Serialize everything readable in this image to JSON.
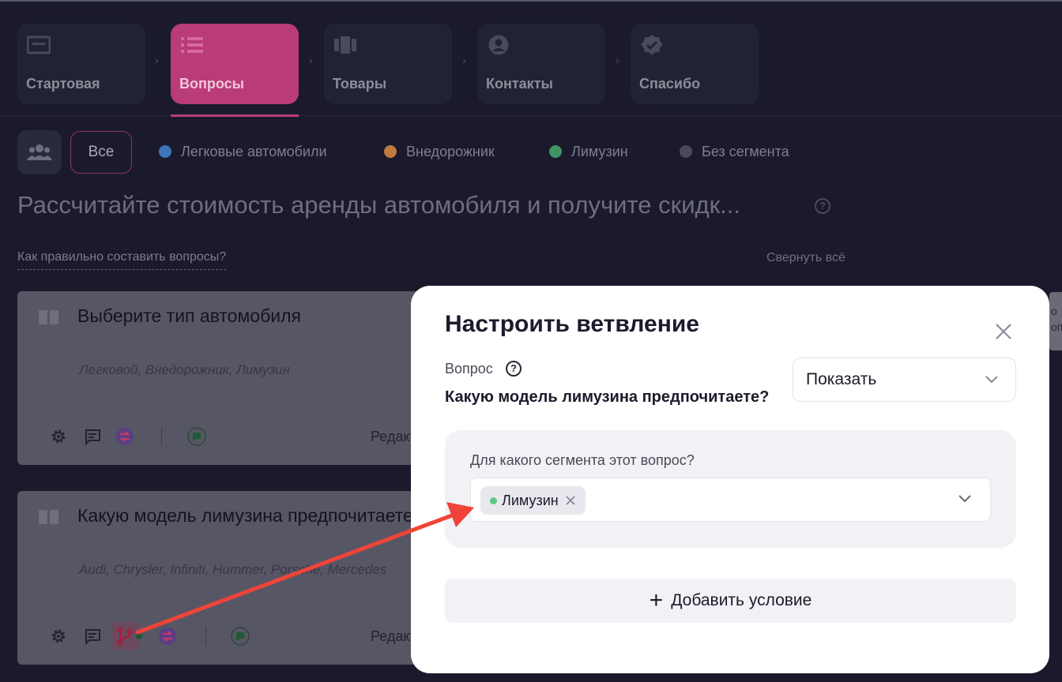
{
  "steps": [
    {
      "label": "Стартовая",
      "icon": "screen-icon",
      "active": false
    },
    {
      "label": "Вопросы",
      "icon": "list-icon",
      "active": true
    },
    {
      "label": "Товары",
      "icon": "products-icon",
      "active": false
    },
    {
      "label": "Контакты",
      "icon": "user-circle-icon",
      "active": false
    },
    {
      "label": "Спасибо",
      "icon": "badge-check-icon",
      "active": false
    }
  ],
  "segments": {
    "all_label": "Все",
    "items": [
      {
        "label": "Легковые автомобили",
        "color": "#3f74b8"
      },
      {
        "label": "Внедорожник",
        "color": "#c07a3e"
      },
      {
        "label": "Лимузин",
        "color": "#3f9463"
      },
      {
        "label": "Без сегмента",
        "color": "#4a4a56"
      }
    ]
  },
  "quiz_title": "Рассчитайте стоимость аренды автомобиля и получите скидк...",
  "howto_link": "Как правильно составить вопросы?",
  "collapse_all": "Свернуть всё",
  "questions": [
    {
      "title": "Выберите тип автомобиля",
      "answers": "Легковой, Внедорожник, Лимузин",
      "edit": "Редактировать"
    },
    {
      "title": "Какую модель лимузина предпочитаете?",
      "answers": "Audi, Chrysler, Infiniti, Hummer, Porsche, Mercedes",
      "edit": "Редактировать"
    }
  ],
  "side_strip_text": "о\nоп",
  "modal": {
    "title": "Настроить ветвление",
    "question_label": "Вопрос",
    "question_text": "Какую модель лимузина предпочитаете?",
    "action_select": "Показать",
    "segment_label": "Для какого сегмента этот вопрос?",
    "chip_label": "Лимузин",
    "chip_color": "#5ec987",
    "add_condition": "Добавить условие"
  },
  "colors": {
    "accent": "#b93b78",
    "background": "#1a1a2c",
    "annotation_arrow": "#f0443a"
  }
}
